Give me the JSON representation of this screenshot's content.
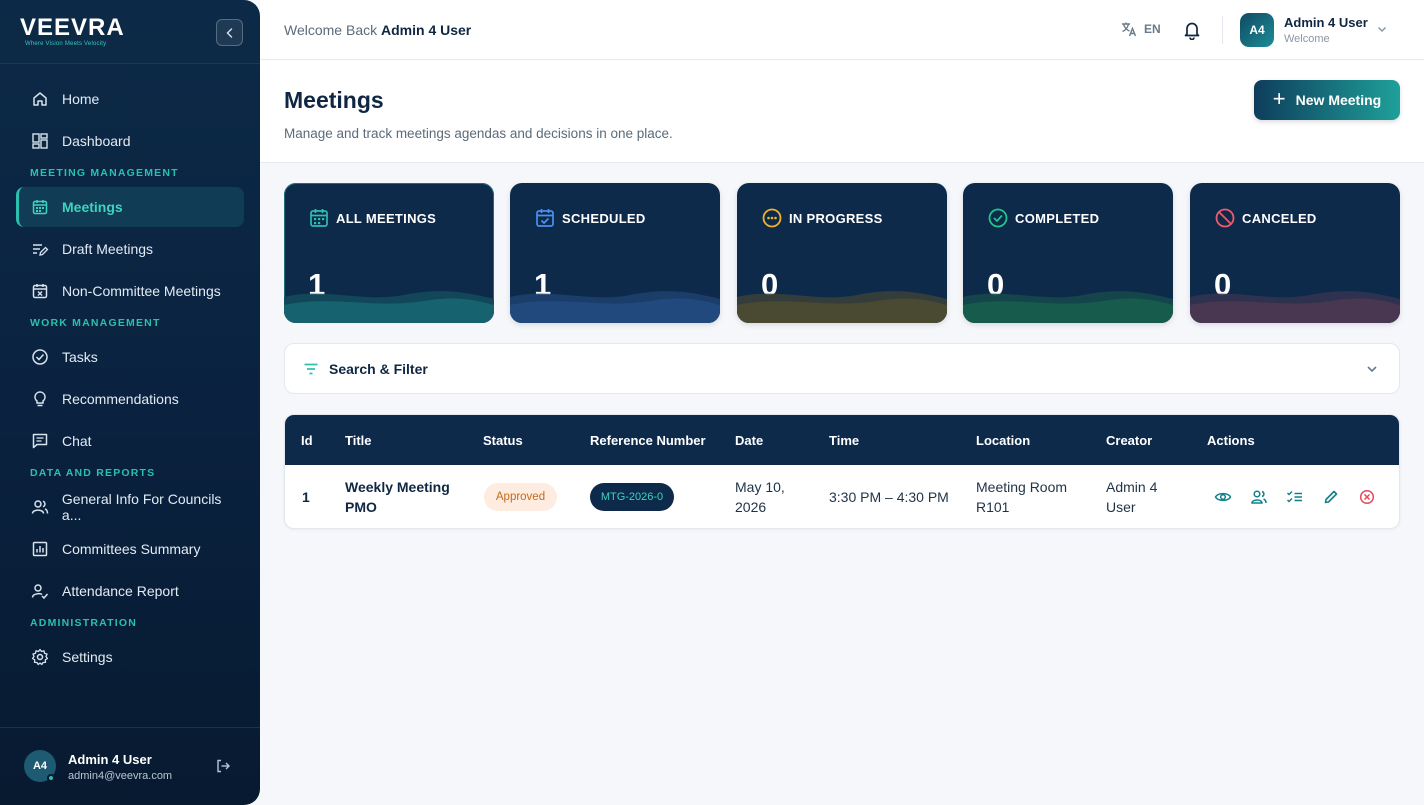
{
  "brand": {
    "name": "VEEVRA",
    "tagline": "Where Vision Meets Velocity"
  },
  "sidebar": {
    "items": [
      {
        "label": "Home",
        "icon": "home-icon"
      },
      {
        "label": "Dashboard",
        "icon": "dashboard-icon"
      }
    ],
    "sections": [
      {
        "title": "MEETING MANAGEMENT",
        "items": [
          {
            "label": "Meetings",
            "icon": "calendar-icon",
            "active": true
          },
          {
            "label": "Draft Meetings",
            "icon": "draft-edit-icon"
          },
          {
            "label": "Non-Committee Meetings",
            "icon": "calendar-x-icon"
          }
        ]
      },
      {
        "title": "WORK MANAGEMENT",
        "items": [
          {
            "label": "Tasks",
            "icon": "check-circle-icon"
          },
          {
            "label": "Recommendations",
            "icon": "lightbulb-icon"
          },
          {
            "label": "Chat",
            "icon": "chat-icon"
          }
        ]
      },
      {
        "title": "DATA AND REPORTS",
        "items": [
          {
            "label": "General Info For Councils a...",
            "icon": "group-icon"
          },
          {
            "label": "Committees Summary",
            "icon": "bar-chart-icon"
          },
          {
            "label": "Attendance Report",
            "icon": "user-check-icon"
          }
        ]
      },
      {
        "title": "ADMINISTRATION",
        "items": [
          {
            "label": "Settings",
            "icon": "gear-icon"
          }
        ]
      }
    ],
    "footer": {
      "initials": "A4",
      "name": "Admin 4 User",
      "email": "admin4@veevra.com"
    }
  },
  "topbar": {
    "welcome_prefix": "Welcome Back",
    "welcome_user": "Admin 4 User",
    "language": "EN",
    "user": {
      "initials": "A4",
      "name": "Admin 4 User",
      "subtitle": "Welcome"
    }
  },
  "page": {
    "title": "Meetings",
    "subtitle": "Manage and track meetings agendas and decisions in one place.",
    "new_button": "New Meeting"
  },
  "stats": [
    {
      "label": "ALL MEETINGS",
      "value": "1",
      "color": "#2bbfae",
      "icon": "calendar-icon"
    },
    {
      "label": "SCHEDULED",
      "value": "1",
      "color": "#4b8ff0",
      "icon": "calendar-check-icon"
    },
    {
      "label": "IN PROGRESS",
      "value": "0",
      "color": "#f0b429",
      "icon": "more-circle-icon"
    },
    {
      "label": "COMPLETED",
      "value": "0",
      "color": "#22c58b",
      "icon": "check-circle-icon"
    },
    {
      "label": "CANCELED",
      "value": "0",
      "color": "#ef5b6a",
      "icon": "ban-icon"
    }
  ],
  "filter": {
    "label": "Search & Filter"
  },
  "table": {
    "columns": [
      "Id",
      "Title",
      "Status",
      "Reference Number",
      "Date",
      "Time",
      "Location",
      "Creator",
      "Actions"
    ],
    "rows": [
      {
        "id": "1",
        "title_line1": "Weekly Meeting",
        "title_line2": "PMO",
        "status": "Approved",
        "reference": "MTG-2026-0",
        "date_line1": "May 10,",
        "date_line2": "2026",
        "time": "3:30 PM – 4:30 PM",
        "location_line1": "Meeting Room",
        "location_line2": "R101",
        "creator_line1": "Admin 4",
        "creator_line2": "User",
        "actions": [
          "eye-icon",
          "participants-icon",
          "checklist-icon",
          "edit-icon",
          "cancel-circle-icon"
        ]
      }
    ]
  }
}
